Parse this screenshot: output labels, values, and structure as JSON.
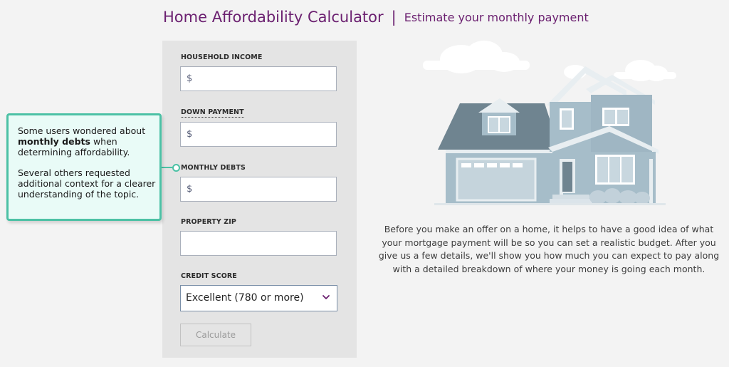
{
  "header": {
    "title": "Home Affordability Calculator",
    "separator": "|",
    "subtitle": "Estimate your monthly payment"
  },
  "form": {
    "household_income": {
      "label": "HOUSEHOLD INCOME",
      "prefix": "$",
      "value": ""
    },
    "down_payment": {
      "label": "DOWN PAYMENT",
      "prefix": "$",
      "value": ""
    },
    "monthly_debts": {
      "label": "MONTHLY DEBTS",
      "prefix": "$",
      "value": ""
    },
    "property_zip": {
      "label": "PROPERTY ZIP",
      "value": ""
    },
    "credit_score": {
      "label": "CREDIT SCORE",
      "selected": "Excellent (780 or more)"
    },
    "calculate_label": "Calculate"
  },
  "callout": {
    "para1_prefix": "Some users wondered about ",
    "para1_bold": "monthly debts",
    "para1_suffix": " when determining affordability.",
    "para2": "Several others requested additional context for a clearer understanding of the topic."
  },
  "description": "Before you make an offer on a home, it helps to have a good idea of what your mortgage payment will be so you can set a realistic budget. After you give us a few details, we'll show you how much you can expect to pay along with a detailed breakdown of where your money is going each month.",
  "colors": {
    "brand": "#6b2070",
    "callout_accent": "#4cc1a5",
    "panel_bg": "#e4e4e4"
  },
  "icons": {
    "house_illustration": "house-illustration",
    "select_arrow": "chevron-down-icon"
  }
}
